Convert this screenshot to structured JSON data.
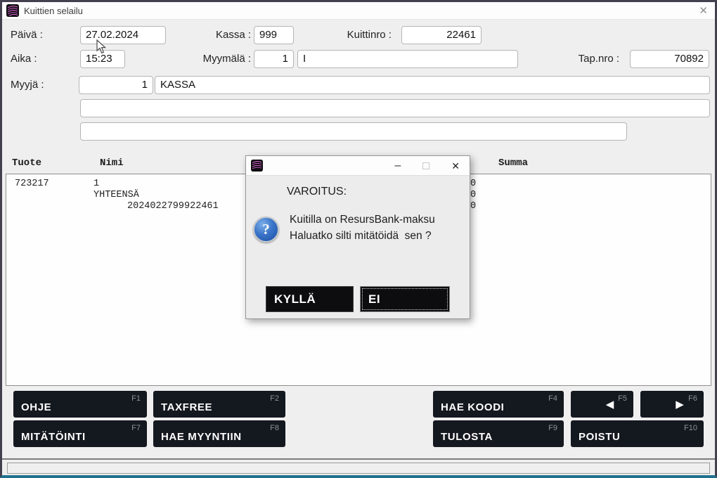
{
  "window": {
    "title": "Kuittien selailu",
    "close_glyph": "✕"
  },
  "form": {
    "paiva_label": "Päivä :",
    "paiva_value": "27.02.2024",
    "kassa_label": "Kassa :",
    "kassa_value": "999",
    "kuittinro_label": "Kuittinro :",
    "kuittinro_value": "22461",
    "aika_label": "Aika :",
    "aika_value": "15:23",
    "myymala_label": "Myymälä :",
    "myymala_number": "1",
    "myymala_name": "I",
    "tapnro_label": "Tap.nro :",
    "tapnro_value": "70892",
    "myyja_label": "Myyjä :",
    "myyja_number": "1",
    "myyja_name": "KASSA",
    "extra_field1": "",
    "extra_field2": ""
  },
  "table": {
    "header_tuote": "Tuote",
    "header_nimi": "Nimi",
    "header_summa": "Summa",
    "rows": [
      {
        "tuote": "723217",
        "nimi": "1",
        "ref": "",
        "partial": "0"
      },
      {
        "tuote": "",
        "nimi": "YHTEENSÄ",
        "ref": "",
        "partial": "0"
      },
      {
        "tuote": "",
        "nimi": "",
        "ref": "2024022799922461",
        "partial": "0"
      }
    ]
  },
  "dialog": {
    "minimize_glyph": "–",
    "close_glyph": "✕",
    "heading": "VAROITUS:",
    "question_glyph": "?",
    "message_line1": "Kuitilla on ResursBank-maksu",
    "message_line2": "Haluatko silti mitätöidä  sen ?",
    "yes_label": "KYLLÄ",
    "no_label": "EI"
  },
  "fbuttons": [
    {
      "label": "OHJE",
      "fkey": "F1"
    },
    {
      "label": "TAXFREE",
      "fkey": "F2"
    },
    {
      "label": "HAE KOODI",
      "fkey": "F4"
    },
    {
      "label": "◀",
      "fkey": "F5"
    },
    {
      "label": "▶",
      "fkey": "F6"
    },
    {
      "label": "MITÄTÖINTI",
      "fkey": "F7"
    },
    {
      "label": "HAE MYYNTIIN",
      "fkey": "F8"
    },
    {
      "label": "TULOSTA",
      "fkey": "F9"
    },
    {
      "label": "POISTU",
      "fkey": "F10"
    }
  ],
  "colors": {
    "window_border": "#454050",
    "bottom_border": "#20718f",
    "button_bg": "#14181f",
    "logo_pink": "#d963cf",
    "help_icon_blue": "#2b66c0"
  }
}
